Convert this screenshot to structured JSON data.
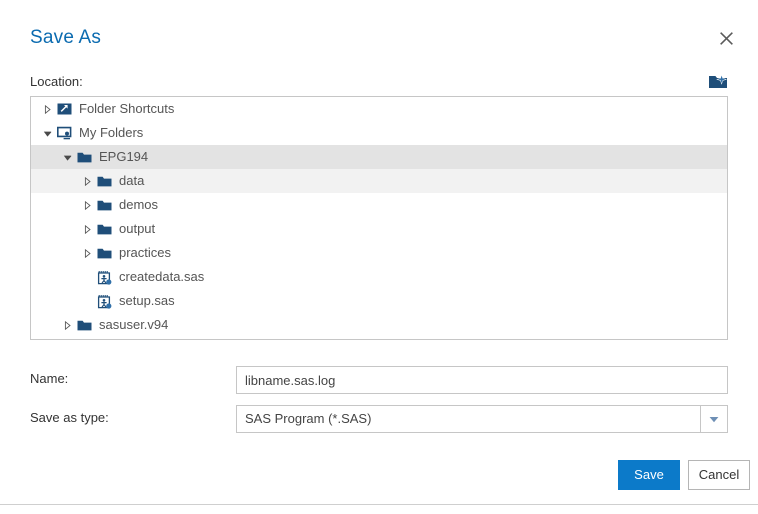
{
  "dialog": {
    "title": "Save As",
    "close_icon": "close-icon"
  },
  "location": {
    "label": "Location:",
    "new_folder_icon": "new-folder-icon"
  },
  "tree": {
    "items": [
      {
        "label": "Folder Shortcuts",
        "icon": "folder-shortcut-icon",
        "depth": 0,
        "state": "collapsed",
        "selected": false,
        "hovered": false
      },
      {
        "label": "My Folders",
        "icon": "my-folders-icon",
        "depth": 0,
        "state": "expanded",
        "selected": false,
        "hovered": false
      },
      {
        "label": "EPG194",
        "icon": "folder-icon",
        "depth": 1,
        "state": "expanded",
        "selected": true,
        "hovered": false
      },
      {
        "label": "data",
        "icon": "folder-icon",
        "depth": 2,
        "state": "collapsed",
        "selected": false,
        "hovered": true
      },
      {
        "label": "demos",
        "icon": "folder-icon",
        "depth": 2,
        "state": "collapsed",
        "selected": false,
        "hovered": false
      },
      {
        "label": "output",
        "icon": "folder-icon",
        "depth": 2,
        "state": "collapsed",
        "selected": false,
        "hovered": false
      },
      {
        "label": "practices",
        "icon": "folder-icon",
        "depth": 2,
        "state": "collapsed",
        "selected": false,
        "hovered": false
      },
      {
        "label": "createdata.sas",
        "icon": "sas-program-icon",
        "depth": 2,
        "state": "leaf",
        "selected": false,
        "hovered": false
      },
      {
        "label": "setup.sas",
        "icon": "sas-program-icon",
        "depth": 2,
        "state": "leaf",
        "selected": false,
        "hovered": false
      },
      {
        "label": "sasuser.v94",
        "icon": "folder-icon",
        "depth": 1,
        "state": "collapsed",
        "selected": false,
        "hovered": false
      }
    ]
  },
  "fields": {
    "name": {
      "label": "Name:",
      "value": "libname.sas.log",
      "placeholder": ""
    },
    "save_as_type": {
      "label": "Save as type:",
      "value": "SAS Program (*.SAS)",
      "options": [
        "SAS Program (*.SAS)"
      ],
      "arrow_icon": "chevron-down-icon"
    }
  },
  "footer": {
    "save_label": "Save",
    "cancel_label": "Cancel"
  },
  "colors": {
    "title_blue": "#0b6bb0",
    "primary_blue": "#0c7ac9",
    "icon_navy": "#1f4e79",
    "selected_row": "#e3e3e3",
    "hovered_row": "#f2f2f2",
    "border_gray": "#c6c6c6"
  }
}
